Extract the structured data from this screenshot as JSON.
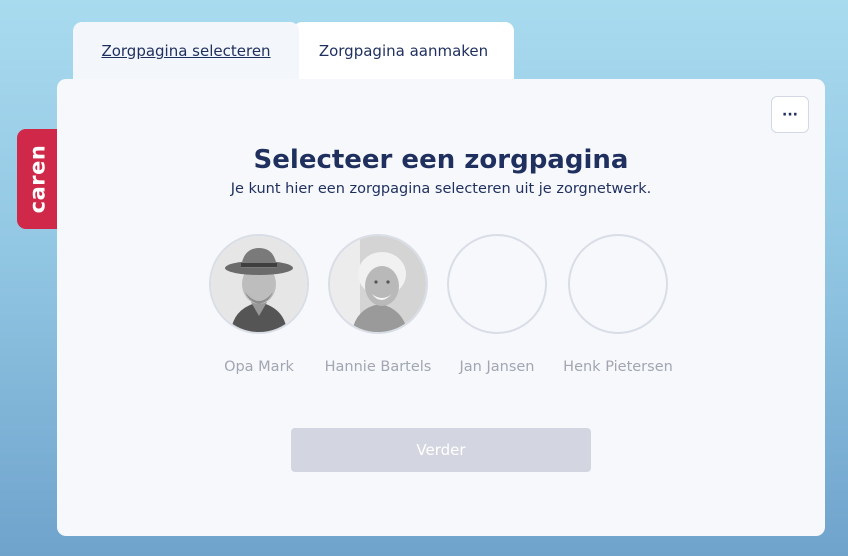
{
  "brand": {
    "name": "caren",
    "color": "#cf2849"
  },
  "tabs": [
    {
      "label": "Zorgpagina selecteren",
      "active": true
    },
    {
      "label": "Zorgpagina aanmaken",
      "active": false
    }
  ],
  "card": {
    "more_label": "···",
    "title": "Selecteer een zorgpagina",
    "subtitle": "Je kunt hier een zorgpagina selecteren uit je zorgnetwerk.",
    "people": [
      {
        "name": "Opa Mark",
        "avatar": "photo"
      },
      {
        "name": "Hannie Bartels",
        "avatar": "photo"
      },
      {
        "name": "Jan Jansen",
        "avatar": "empty"
      },
      {
        "name": "Henk Pietersen",
        "avatar": "empty"
      }
    ],
    "continue_label": "Verder"
  }
}
